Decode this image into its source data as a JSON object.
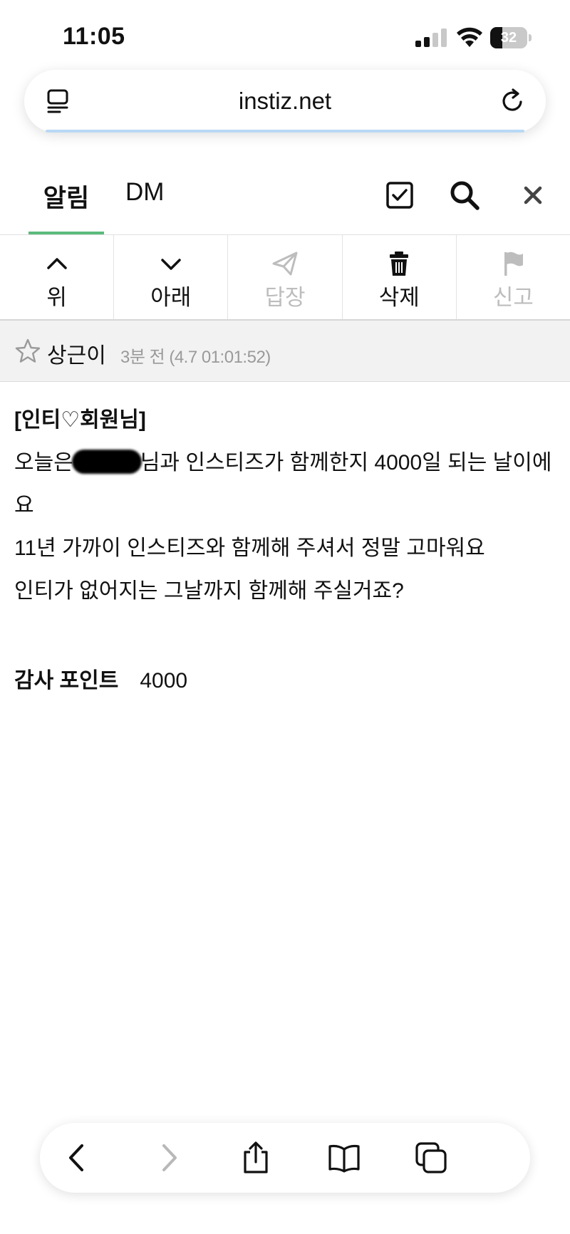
{
  "status_bar": {
    "time": "11:05",
    "battery": "32",
    "battery_level": 0.32
  },
  "browser": {
    "domain": "instiz.net"
  },
  "tabs": [
    {
      "label": "알림",
      "active": true
    },
    {
      "label": "DM",
      "active": false
    }
  ],
  "toolbar": [
    {
      "label": "위",
      "icon": "chevron-up-icon",
      "enabled": true
    },
    {
      "label": "아래",
      "icon": "chevron-down-icon",
      "enabled": true
    },
    {
      "label": "답장",
      "icon": "paper-plane-icon",
      "enabled": false
    },
    {
      "label": "삭제",
      "icon": "trash-icon",
      "enabled": true
    },
    {
      "label": "신고",
      "icon": "flag-icon",
      "enabled": false
    }
  ],
  "message": {
    "sender": "상근이",
    "time": "3분 전 (4.7 01:01:52)",
    "title": "[인티♡회원님]",
    "line1_before": "오늘은",
    "line1_after": "님과 인스티즈가 함께한지 4000일 되는 날이에",
    "line1_wrap": "요",
    "line2": "11년 가까이 인스티즈와 함께해 주셔서 정말 고마워요",
    "line3": "인티가 없어지는 그날까지 함께해 주실거죠?",
    "points_label": "감사 포인트",
    "points_value": "4000"
  },
  "colors": {
    "accent": "#5bbb7b",
    "disabled": "#bdbdbd",
    "header_bg": "#f2f2f2"
  }
}
